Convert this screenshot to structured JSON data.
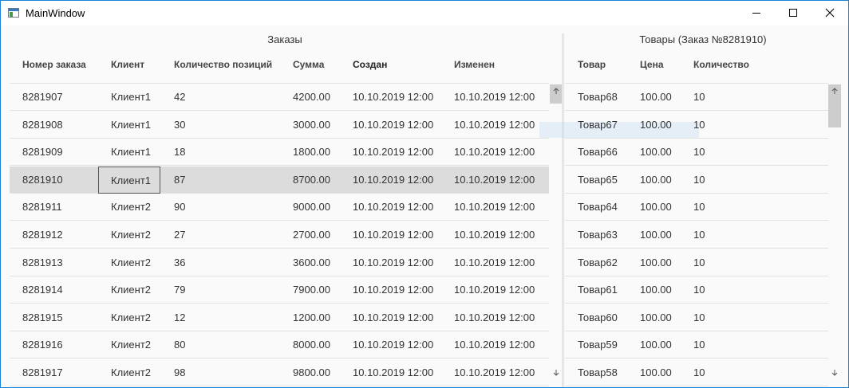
{
  "window": {
    "title": "MainWindow"
  },
  "orders": {
    "title": "Заказы",
    "columns": [
      "Номер заказа",
      "Клиент",
      "Количество позиций",
      "Сумма",
      "Создан",
      "Изменен"
    ],
    "rows": [
      [
        "8281907",
        "Клиент1",
        "42",
        "4200.00",
        "10.10.2019 12:00",
        "10.10.2019 12:00"
      ],
      [
        "8281908",
        "Клиент1",
        "30",
        "3000.00",
        "10.10.2019 12:00",
        "10.10.2019 12:00"
      ],
      [
        "8281909",
        "Клиент1",
        "18",
        "1800.00",
        "10.10.2019 12:00",
        "10.10.2019 12:00"
      ],
      [
        "8281910",
        "Клиент1",
        "87",
        "8700.00",
        "10.10.2019 12:00",
        "10.10.2019 12:00"
      ],
      [
        "8281911",
        "Клиент2",
        "90",
        "9000.00",
        "10.10.2019 12:00",
        "10.10.2019 12:00"
      ],
      [
        "8281912",
        "Клиент2",
        "27",
        "2700.00",
        "10.10.2019 12:00",
        "10.10.2019 12:00"
      ],
      [
        "8281913",
        "Клиент2",
        "36",
        "3600.00",
        "10.10.2019 12:00",
        "10.10.2019 12:00"
      ],
      [
        "8281914",
        "Клиент2",
        "79",
        "7900.00",
        "10.10.2019 12:00",
        "10.10.2019 12:00"
      ],
      [
        "8281915",
        "Клиент2",
        "12",
        "1200.00",
        "10.10.2019 12:00",
        "10.10.2019 12:00"
      ],
      [
        "8281916",
        "Клиент2",
        "80",
        "8000.00",
        "10.10.2019 12:00",
        "10.10.2019 12:00"
      ],
      [
        "8281917",
        "Клиент2",
        "98",
        "9800.00",
        "10.10.2019 12:00",
        "10.10.2019 12:00"
      ]
    ]
  },
  "goods": {
    "title": "Товары (Заказ №8281910)",
    "columns": [
      "Товар",
      "Цена",
      "Количество"
    ],
    "rows": [
      [
        "Товар68",
        "100.00",
        "10"
      ],
      [
        "Товар67",
        "100.00",
        "10"
      ],
      [
        "Товар66",
        "100.00",
        "10"
      ],
      [
        "Товар65",
        "100.00",
        "10"
      ],
      [
        "Товар64",
        "100.00",
        "10"
      ],
      [
        "Товар63",
        "100.00",
        "10"
      ],
      [
        "Товар62",
        "100.00",
        "10"
      ],
      [
        "Товар61",
        "100.00",
        "10"
      ],
      [
        "Товар60",
        "100.00",
        "10"
      ],
      [
        "Товар59",
        "100.00",
        "10"
      ],
      [
        "Товар58",
        "100.00",
        "10"
      ]
    ]
  },
  "icons": {
    "app": "app-window-icon",
    "minimize": "minimize-icon",
    "maximize": "maximize-icon",
    "close": "close-icon",
    "scroll_up": "arrow-up-icon",
    "scroll_down": "arrow-down-icon"
  },
  "colors": {
    "window_border": "#1883d7",
    "selected_row": "#dcdcdc",
    "scroll_thumb": "#cdcdcd"
  }
}
